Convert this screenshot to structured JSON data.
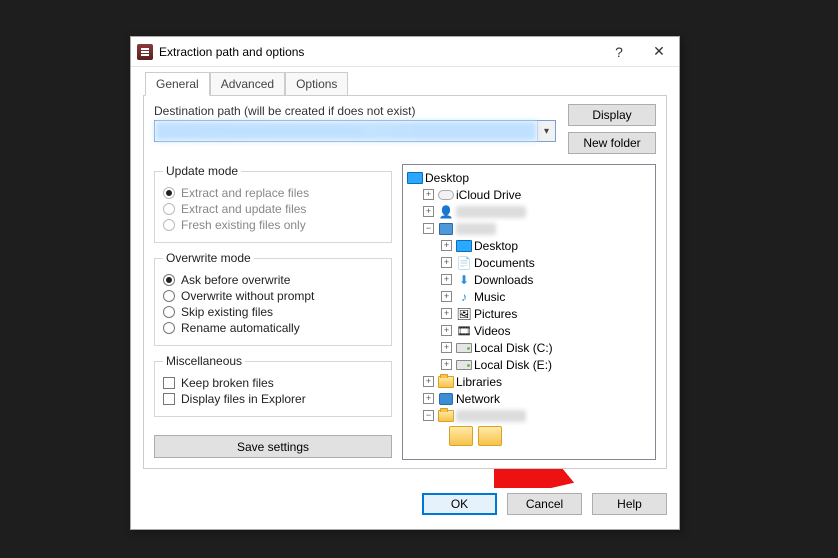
{
  "title": "Extraction path and options",
  "tabs": [
    "General",
    "Advanced",
    "Options"
  ],
  "dest_label": "Destination path (will be created if does not exist)",
  "buttons_top": {
    "display": "Display",
    "new_folder": "New folder"
  },
  "update_mode": {
    "legend": "Update mode",
    "items": [
      "Extract and replace files",
      "Extract and update files",
      "Fresh existing files only"
    ]
  },
  "overwrite_mode": {
    "legend": "Overwrite mode",
    "items": [
      "Ask before overwrite",
      "Overwrite without prompt",
      "Skip existing files",
      "Rename automatically"
    ]
  },
  "misc": {
    "legend": "Miscellaneous",
    "items": [
      "Keep broken files",
      "Display files in Explorer"
    ]
  },
  "save_settings": "Save settings",
  "tree": {
    "desktop": "Desktop",
    "icloud": "iCloud Drive",
    "user_desktop": "Desktop",
    "documents": "Documents",
    "downloads": "Downloads",
    "music": "Music",
    "pictures": "Pictures",
    "videos": "Videos",
    "disk_c": "Local Disk (C:)",
    "disk_e": "Local Disk (E:)",
    "libraries": "Libraries",
    "network": "Network"
  },
  "footer": {
    "ok": "OK",
    "cancel": "Cancel",
    "help": "Help"
  }
}
